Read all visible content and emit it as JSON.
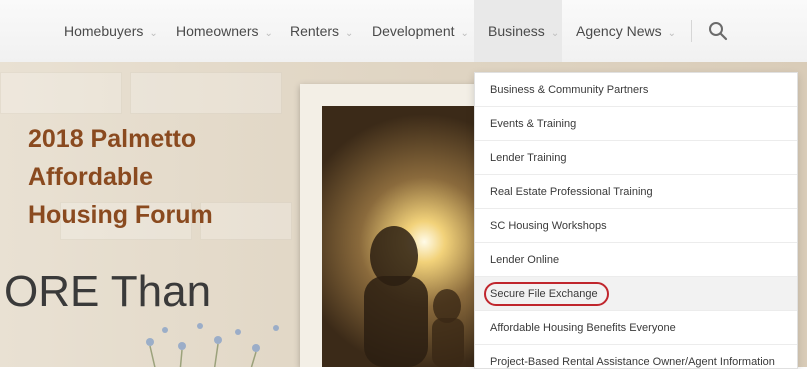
{
  "nav": {
    "items": [
      {
        "label": "Homebuyers"
      },
      {
        "label": "Homeowners"
      },
      {
        "label": "Renters"
      },
      {
        "label": "Development"
      },
      {
        "label": "Business"
      },
      {
        "label": "Agency News"
      }
    ],
    "chevron_glyph": "⌄",
    "active_item": "Business",
    "search_icon": "search-icon"
  },
  "hero": {
    "title_lines": [
      "2018 Palmetto",
      "Affordable",
      "Housing Forum"
    ],
    "tagline_fragment": "ORE Than",
    "title_color": "#8a4a1f"
  },
  "dropdown": {
    "items": [
      {
        "label": "Business & Community Partners"
      },
      {
        "label": "Events & Training"
      },
      {
        "label": "Lender Training"
      },
      {
        "label": "Real Estate Professional Training"
      },
      {
        "label": "SC Housing Workshops"
      },
      {
        "label": "Lender Online"
      },
      {
        "label": "Secure File Exchange"
      },
      {
        "label": "Affordable Housing Benefits Everyone"
      },
      {
        "label": "Project-Based Rental Assistance Owner/Agent Information"
      }
    ],
    "highlighted_item": "Secure File Exchange",
    "highlight_color": "#c0262d"
  }
}
